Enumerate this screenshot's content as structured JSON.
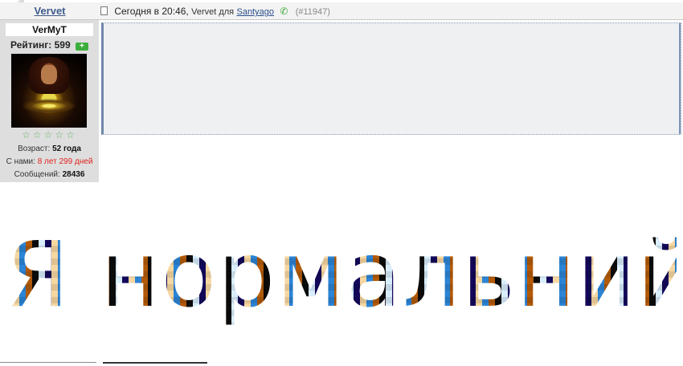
{
  "post": {
    "author_link": "Vervet",
    "date": "Сегодня в 20:46,",
    "byline": "Vervet для",
    "recipient": "Santyago",
    "post_id": "(#11947)"
  },
  "user": {
    "username": "VerMyT",
    "rating_label": "Рейтинг: 599",
    "stars": "☆☆☆☆☆",
    "age_label": "Возраст:",
    "age_value": "52 года",
    "since_label": "С нами:",
    "since_value": "8 лет 299 дней",
    "posts_label": "Сообщений:",
    "posts_value": "28436"
  },
  "content": {
    "big_text": "Я нормальний"
  },
  "colors": {
    "link": "#3f5b8c",
    "since_value": "#e0231e",
    "rating_plus": "#3cae3c"
  },
  "icons": [
    "document-icon",
    "phone-icon",
    "plus-icon",
    "star-icon"
  ]
}
